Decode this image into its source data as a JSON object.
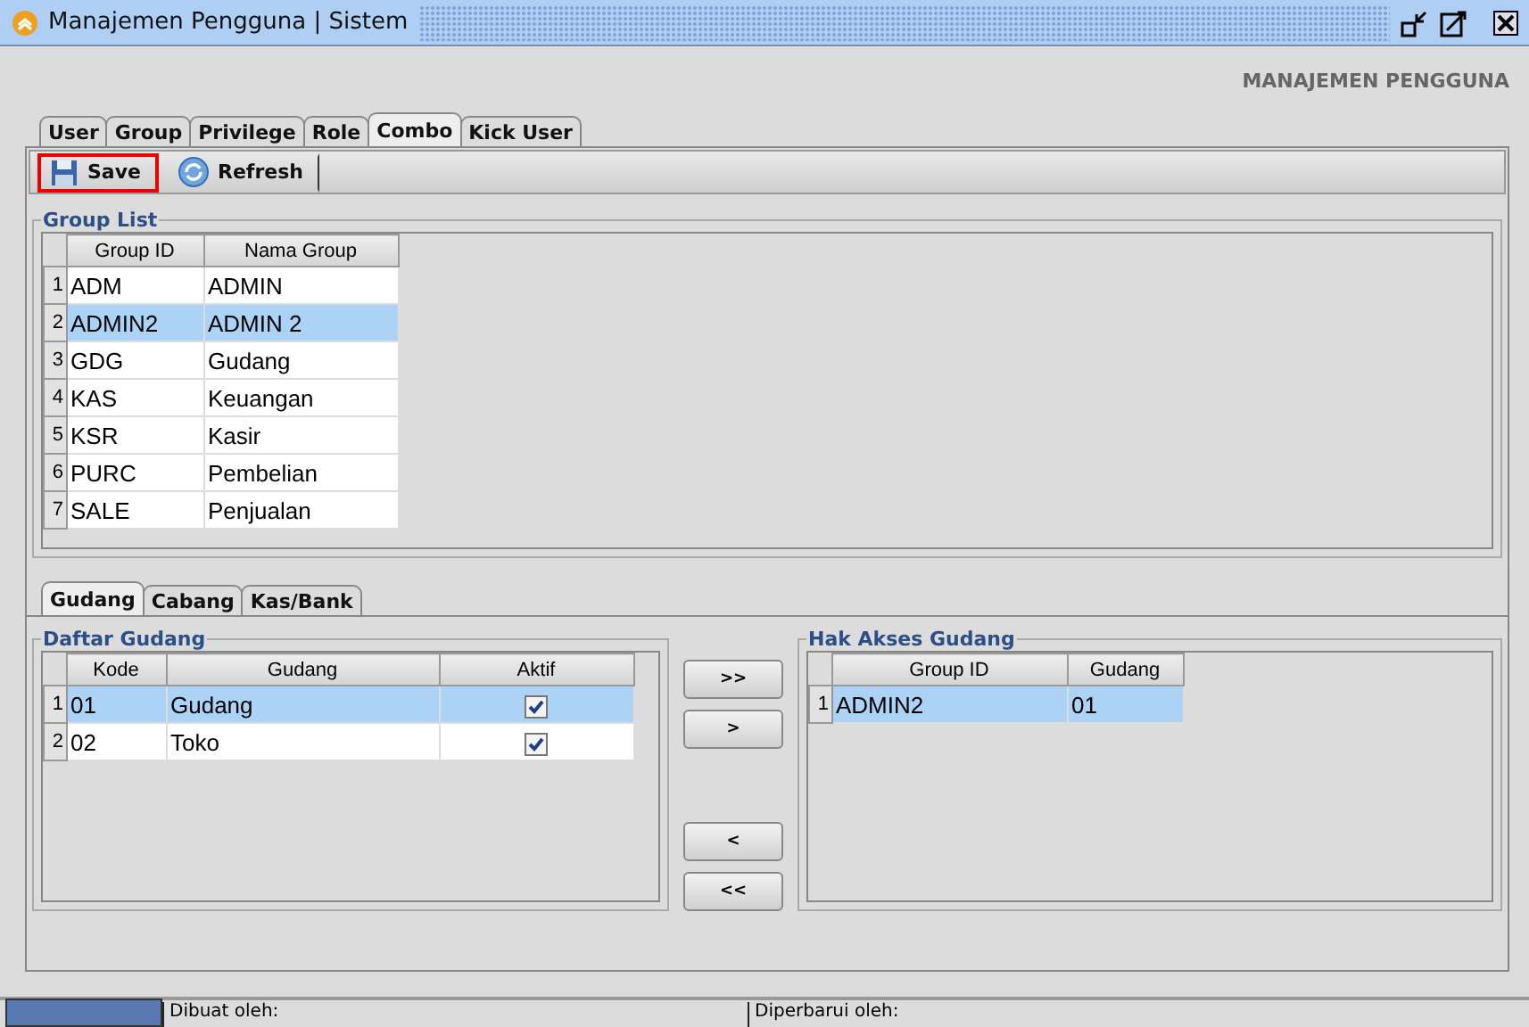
{
  "window": {
    "title": "Manajemen Pengguna | Sistem"
  },
  "header": "MANAJEMEN PENGGUNA",
  "tabs": [
    {
      "label": "User",
      "selected": false
    },
    {
      "label": "Group",
      "selected": false
    },
    {
      "label": "Privilege",
      "selected": false
    },
    {
      "label": "Role",
      "selected": false
    },
    {
      "label": "Combo",
      "selected": true
    },
    {
      "label": "Kick User",
      "selected": false
    }
  ],
  "toolbar": [
    {
      "label": "Save",
      "kind": "save",
      "focused": true
    },
    {
      "label": "Refresh",
      "kind": "refresh",
      "focused": false
    }
  ],
  "group_list": {
    "title": "Group List",
    "columns": [
      "Group ID",
      "Nama Group"
    ],
    "rows": [
      {
        "num": "1",
        "cells": [
          "ADM",
          "ADMIN"
        ],
        "selected": false
      },
      {
        "num": "2",
        "cells": [
          "ADMIN2",
          "ADMIN 2"
        ],
        "selected": true
      },
      {
        "num": "3",
        "cells": [
          "GDG",
          "Gudang"
        ],
        "selected": false
      },
      {
        "num": "4",
        "cells": [
          "KAS",
          "Keuangan"
        ],
        "selected": false
      },
      {
        "num": "5",
        "cells": [
          "KSR",
          "Kasir"
        ],
        "selected": false
      },
      {
        "num": "6",
        "cells": [
          "PURC",
          "Pembelian"
        ],
        "selected": false
      },
      {
        "num": "7",
        "cells": [
          "SALE",
          "Penjualan"
        ],
        "selected": false
      }
    ]
  },
  "sub_tabs": [
    {
      "label": "Gudang",
      "selected": true
    },
    {
      "label": "Cabang",
      "selected": false
    },
    {
      "label": "Kas/Bank",
      "selected": false
    }
  ],
  "daftar_gudang": {
    "title": "Daftar Gudang",
    "columns": [
      "Kode",
      "Gudang",
      "Aktif"
    ],
    "rows": [
      {
        "num": "1",
        "kode": "01",
        "gudang": "Gudang",
        "checked": true,
        "selected": true
      },
      {
        "num": "2",
        "kode": "02",
        "gudang": "Toko",
        "checked": true,
        "selected": false
      }
    ]
  },
  "move_buttons": [
    ">>",
    ">",
    "<",
    "<<"
  ],
  "hak_akses": {
    "title": "Hak Akses Gudang",
    "columns": [
      "Group ID",
      "Gudang"
    ],
    "rows": [
      {
        "num": "1",
        "cells": [
          "ADMIN2",
          "01"
        ],
        "selected": true
      }
    ]
  },
  "status_bar": [
    "Dibuat oleh:",
    "Diperbarui oleh:"
  ]
}
